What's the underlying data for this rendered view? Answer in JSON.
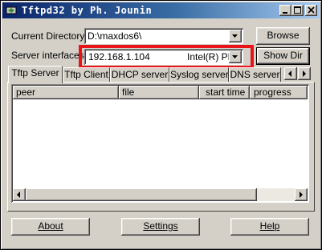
{
  "window": {
    "title": "Tftpd32 by Ph. Jounin"
  },
  "form": {
    "current_directory_label": "Current Directory",
    "current_directory_value": "D:\\maxdos6\\",
    "server_interfaces_label": "Server interfaces",
    "server_ip": "192.168.1.104",
    "server_adapter": "Intel(R) PF",
    "browse_label": "Browse",
    "show_dir_label": "Show Dir"
  },
  "tabs": [
    {
      "label": "Tftp Server"
    },
    {
      "label": "Tftp Client"
    },
    {
      "label": "DHCP server"
    },
    {
      "label": "Syslog server"
    },
    {
      "label": "DNS server"
    }
  ],
  "list": {
    "columns": [
      "peer",
      "file",
      "start time",
      "progress"
    ]
  },
  "footer": {
    "about_label": "About",
    "settings_label": "Settings",
    "help_label": "Help"
  },
  "colors": {
    "highlight": "#e8141a",
    "title_bar_start": "#0a246a",
    "title_bar_end": "#a6caf0",
    "face": "#d4d0c8"
  }
}
